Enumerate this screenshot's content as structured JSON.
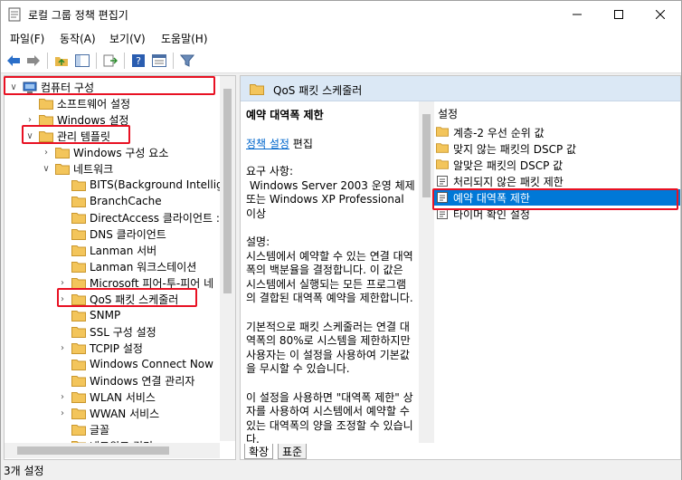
{
  "window": {
    "title": "로컬 그룹 정책 편집기"
  },
  "menu": [
    "파일(F)",
    "동작(A)",
    "보기(V)",
    "도움말(H)"
  ],
  "toolbar_icons": [
    "back-icon",
    "forward-icon",
    "up-folder-icon",
    "show-hide-tree-icon",
    "export-list-icon",
    "help-icon",
    "properties-icon",
    "filter-icon"
  ],
  "tree": [
    {
      "label": "컴퓨터 구성",
      "expanded": true,
      "highlight": true
    },
    {
      "label": "소프트웨어 설정"
    },
    {
      "label": "Windows 설정"
    },
    {
      "label": "관리 템플릿",
      "expanded": true,
      "highlight": true
    },
    {
      "label": "Windows 구성 요소"
    },
    {
      "label": "네트워크",
      "expanded": true
    },
    {
      "label": "BITS(Background Intellige"
    },
    {
      "label": "BranchCache"
    },
    {
      "label": "DirectAccess 클라이언트 :"
    },
    {
      "label": "DNS 클라이언트"
    },
    {
      "label": "Lanman 서버"
    },
    {
      "label": "Lanman 워크스테이션"
    },
    {
      "label": "Microsoft 피어-투-피어 네"
    },
    {
      "label": "QoS 패킷 스케줄러",
      "highlight": true
    },
    {
      "label": "SNMP"
    },
    {
      "label": "SSL 구성 설정"
    },
    {
      "label": "TCPIP 설정"
    },
    {
      "label": "Windows Connect Now"
    },
    {
      "label": "Windows 연결 관리자"
    },
    {
      "label": "WLAN 서비스"
    },
    {
      "label": "WWAN 서비스"
    },
    {
      "label": "글꼴"
    },
    {
      "label": "네트워크 격리"
    }
  ],
  "right": {
    "header": "QoS 패킷 스케줄러",
    "desc_title": "예약 대역폭 제한",
    "policy_link": "정책 설정",
    "policy_suffix": " 편집",
    "desc_body": "요구 사항:\n Windows Server 2003 운영 체제 또는 Windows XP Professional 이상\n\n설명:\n시스템에서 예약할 수 있는 연결 대역폭의 백분율을 결정합니다. 이 값은 시스템에서 실행되는 모든 프로그램의 결합된 대역폭 예약을 제한합니다.\n\n기본적으로 패킷 스케줄러는 연결 대역폭의 80%로 시스템을 제한하지만 사용자는 이 설정을 사용하여 기본값을 무시할 수 있습니다.\n\n이 설정을 사용하면 \"대역폭 제한\" 상자를 사용하여 시스템에서 예약할 수 있는 대역폭의 양을 조정할 수 있습니다.",
    "settings_header": "설정",
    "settings": [
      {
        "label": "계층-2 우선 순위 값",
        "type": "folder"
      },
      {
        "label": "맞지 않는 패킷의 DSCP 값",
        "type": "folder"
      },
      {
        "label": "알맞은 패킷의 DSCP 값",
        "type": "folder"
      },
      {
        "label": "처리되지 않은 패킷 제한",
        "type": "policy"
      },
      {
        "label": "예약 대역폭 제한",
        "type": "policy",
        "selected": true,
        "highlight": true
      },
      {
        "label": "타이머 확인 설정",
        "type": "policy"
      }
    ],
    "tabs": [
      "확장",
      "표준"
    ]
  },
  "status": "3개 설정"
}
